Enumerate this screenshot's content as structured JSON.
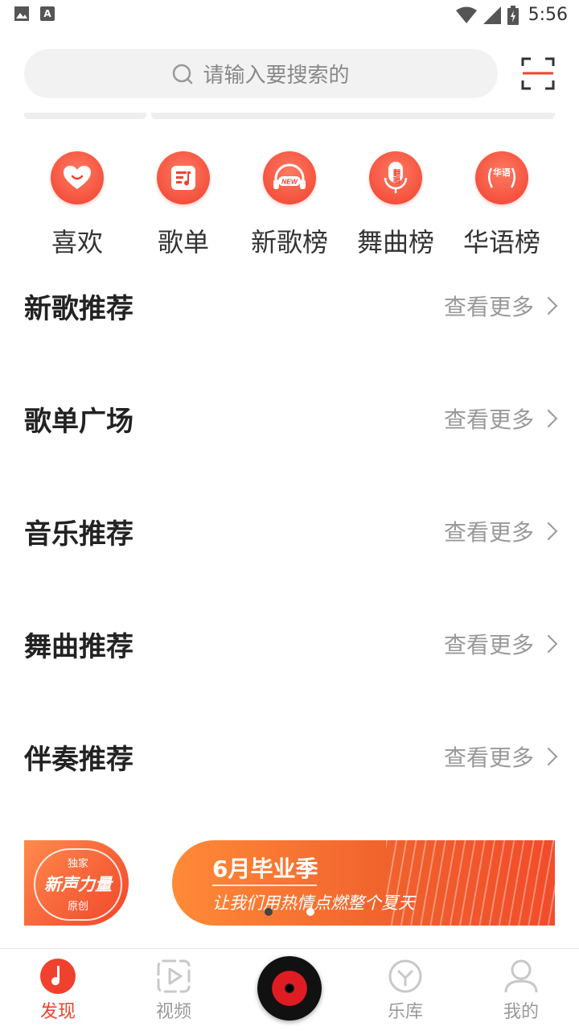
{
  "status_bar": {
    "time": "5:56",
    "left_icons": [
      "image-icon",
      "font-a-icon"
    ],
    "right_icons": [
      "wifi-icon",
      "signal-icon",
      "battery-icon"
    ]
  },
  "search": {
    "placeholder": "请输入要搜索的"
  },
  "categories": [
    {
      "label": "喜欢",
      "icon": "heart-icon"
    },
    {
      "label": "歌单",
      "icon": "playlist-icon"
    },
    {
      "label": "新歌榜",
      "icon": "new-headphones-icon",
      "icon_text": "NEW"
    },
    {
      "label": "舞曲榜",
      "icon": "microphone-icon",
      "icon_text": "翻唱"
    },
    {
      "label": "华语榜",
      "icon": "laurel-badge-icon",
      "icon_text": "华语"
    }
  ],
  "sections": [
    {
      "title": "新歌推荐",
      "more": "查看更多"
    },
    {
      "title": "歌单广场",
      "more": "查看更多"
    },
    {
      "title": "音乐推荐",
      "more": "查看更多"
    },
    {
      "title": "舞曲推荐",
      "more": "查看更多"
    },
    {
      "title": "伴奏推荐",
      "more": "查看更多"
    }
  ],
  "banners": {
    "left": {
      "top": "独家",
      "main": "新声力量",
      "bottom": "原创"
    },
    "right": {
      "title": "6月毕业季",
      "subtitle": "让我们用热情点燃整个夏天"
    },
    "dots": 2,
    "active_dot": 1
  },
  "bottom_nav": [
    {
      "label": "发现",
      "icon": "music-note-icon",
      "active": true
    },
    {
      "label": "视频",
      "icon": "video-play-icon",
      "active": false
    },
    {
      "label": "",
      "icon": "vinyl-disc-icon",
      "active": false
    },
    {
      "label": "乐库",
      "icon": "library-icon",
      "active": false
    },
    {
      "label": "我的",
      "icon": "user-icon",
      "active": false
    }
  ],
  "colors": {
    "accent": "#f0412e",
    "text_primary": "#222222",
    "text_secondary": "#999999",
    "search_bg": "#f2f2f2"
  }
}
